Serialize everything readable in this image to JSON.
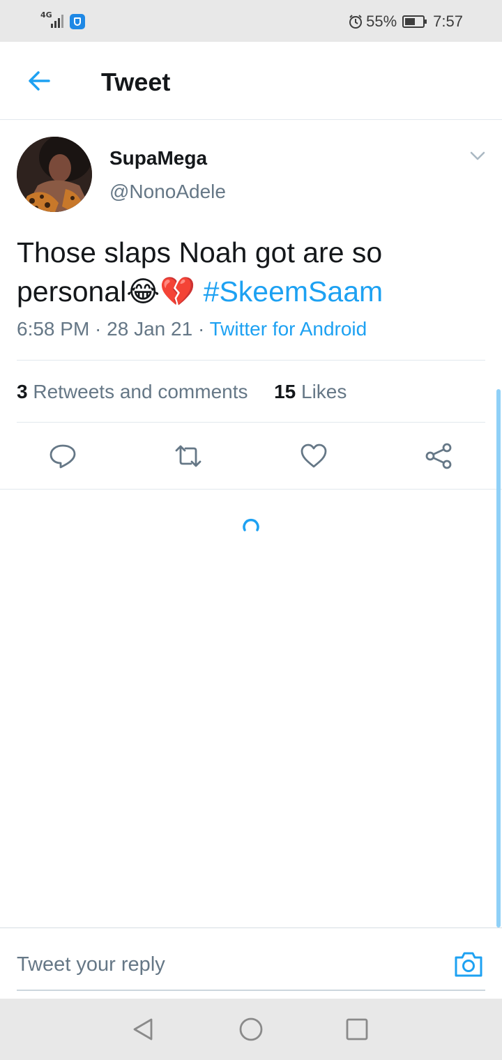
{
  "status_bar": {
    "network": "4G",
    "battery_percent": "55%",
    "time": "7:57",
    "icons": [
      "signal-icon",
      "shield-icon",
      "alarm-icon",
      "battery-icon"
    ]
  },
  "header": {
    "title": "Tweet",
    "back_icon": "back-arrow-icon"
  },
  "tweet": {
    "display_name": "SupaMega",
    "handle": "@NonoAdele",
    "text": "Those slaps Noah got are so personal😂💔",
    "hashtag": "#SkeemSaam",
    "time": "6:58 PM",
    "date": "28 Jan 21",
    "separator": " · ",
    "source": "Twitter for Android",
    "stats": {
      "retweets_count": "3",
      "retweets_label": "Retweets and comments",
      "likes_count": "15",
      "likes_label": "Likes"
    },
    "actions": [
      "reply-icon",
      "retweet-icon",
      "like-icon",
      "share-icon"
    ]
  },
  "reply": {
    "placeholder": "Tweet your reply",
    "camera_icon": "camera-icon"
  },
  "nav": [
    "back-nav-icon",
    "home-nav-icon",
    "recents-nav-icon"
  ],
  "colors": {
    "accent": "#1da1f2",
    "text_primary": "#14171a",
    "text_secondary": "#657786",
    "divider": "#e1e8ed"
  }
}
